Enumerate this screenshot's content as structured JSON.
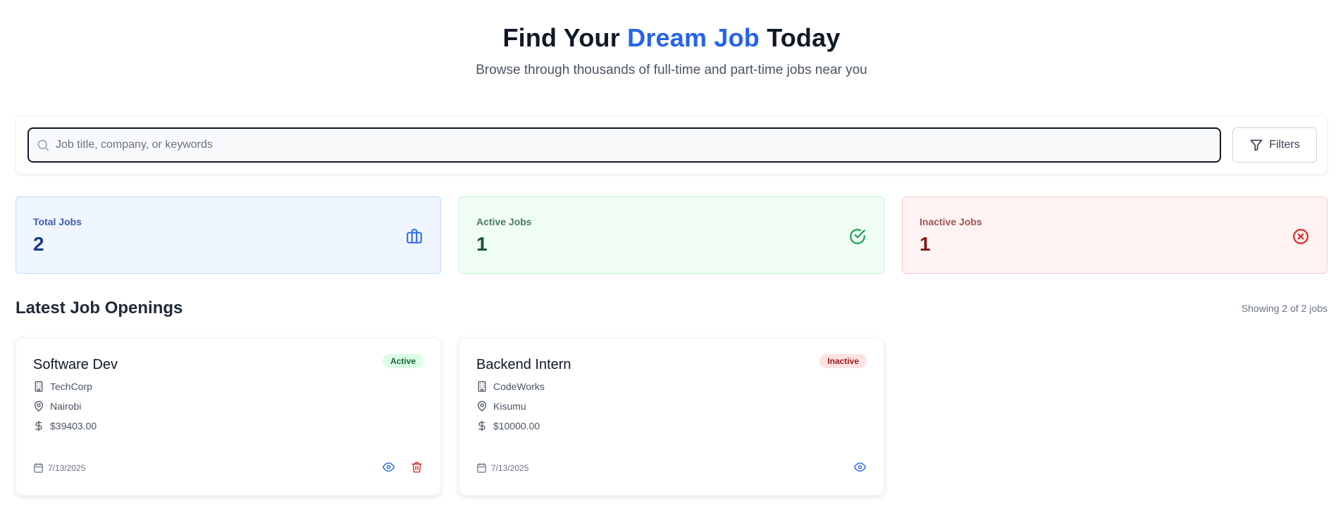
{
  "hero": {
    "title_pre": "Find Your",
    "title_accent": "Dream Job",
    "title_post": "Today",
    "subtitle": "Browse through thousands of full-time and part-time jobs near you"
  },
  "search": {
    "placeholder": "Job title, company, or keywords",
    "value": "",
    "filters_label": "Filters"
  },
  "stats": {
    "total": {
      "label": "Total Jobs",
      "value": "2",
      "icon": "briefcase-icon"
    },
    "active": {
      "label": "Active Jobs",
      "value": "1",
      "icon": "check-circle-icon"
    },
    "inactive": {
      "label": "Inactive Jobs",
      "value": "1",
      "icon": "x-circle-icon"
    }
  },
  "listing": {
    "title": "Latest Job Openings",
    "count_text": "Showing 2 of 2 jobs"
  },
  "jobs": [
    {
      "title": "Software Dev",
      "status": "Active",
      "company": "TechCorp",
      "location": "Nairobi",
      "salary": "$39403.00",
      "date": "7/13/2025"
    },
    {
      "title": "Backend Intern",
      "status": "Inactive",
      "company": "CodeWorks",
      "location": "Kisumu",
      "salary": "$10000.00",
      "date": "7/13/2025"
    }
  ],
  "colors": {
    "accent": "#2563eb",
    "active_badge": "#dcfce7",
    "inactive_badge": "#fee2e2",
    "delete": "#dc2626"
  }
}
